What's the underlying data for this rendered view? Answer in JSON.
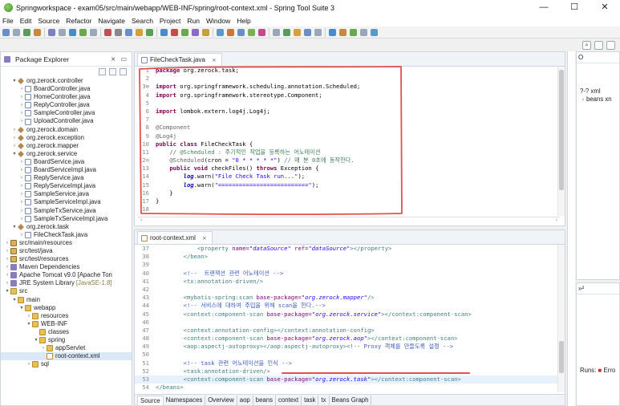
{
  "window": {
    "title": "Springworkspace - exam05/src/main/webapp/WEB-INF/spring/root-context.xml - Spring Tool Suite 3",
    "minimize": "—",
    "maximize": "☐",
    "close": "✕"
  },
  "menu": [
    "File",
    "Edit",
    "Source",
    "Refactor",
    "Navigate",
    "Search",
    "Project",
    "Run",
    "Window",
    "Help"
  ],
  "package_explorer": {
    "title": "Package Explorer",
    "tab_close": "⨯",
    "items": [
      {
        "depth": 1,
        "twisty": "v",
        "icon": "pkg",
        "label": "org.zerock.controller"
      },
      {
        "depth": 2,
        "twisty": ">",
        "icon": "java",
        "label": "BoardController.java"
      },
      {
        "depth": 2,
        "twisty": ">",
        "icon": "java",
        "label": "HomeController.java"
      },
      {
        "depth": 2,
        "twisty": ">",
        "icon": "java",
        "label": "ReplyController.java"
      },
      {
        "depth": 2,
        "twisty": ">",
        "icon": "java",
        "label": "SampleController.java"
      },
      {
        "depth": 2,
        "twisty": ">",
        "icon": "java",
        "label": "UploadController.java"
      },
      {
        "depth": 1,
        "twisty": ">",
        "icon": "pkg",
        "label": "org.zerock.domain"
      },
      {
        "depth": 1,
        "twisty": ">",
        "icon": "pkg",
        "label": "org.zerock.exception"
      },
      {
        "depth": 1,
        "twisty": ">",
        "icon": "pkg",
        "label": "org.zerock.mapper"
      },
      {
        "depth": 1,
        "twisty": "v",
        "icon": "pkg",
        "label": "org.zerock.service"
      },
      {
        "depth": 2,
        "twisty": ">",
        "icon": "java",
        "label": "BoardService.java"
      },
      {
        "depth": 2,
        "twisty": ">",
        "icon": "java",
        "label": "BoardServiceImpl.java"
      },
      {
        "depth": 2,
        "twisty": ">",
        "icon": "java",
        "label": "ReplyService.java"
      },
      {
        "depth": 2,
        "twisty": ">",
        "icon": "java",
        "label": "ReplyServiceImpl.java"
      },
      {
        "depth": 2,
        "twisty": ">",
        "icon": "java",
        "label": "SampleService.java"
      },
      {
        "depth": 2,
        "twisty": ">",
        "icon": "java",
        "label": "SampleServiceImpl.java"
      },
      {
        "depth": 2,
        "twisty": ">",
        "icon": "java",
        "label": "SampleTxService.java"
      },
      {
        "depth": 2,
        "twisty": ">",
        "icon": "java",
        "label": "SampleTxServiceImpl.java"
      },
      {
        "depth": 1,
        "twisty": "v",
        "icon": "pkg",
        "label": "org.zerock.task"
      },
      {
        "depth": 2,
        "twisty": ">",
        "icon": "java",
        "label": "FileCheckTask.java"
      },
      {
        "depth": 0,
        "twisty": ">",
        "icon": "src",
        "label": "src/main/resources"
      },
      {
        "depth": 0,
        "twisty": ">",
        "icon": "src",
        "label": "src/test/java"
      },
      {
        "depth": 0,
        "twisty": ">",
        "icon": "src",
        "label": "src/test/resources"
      },
      {
        "depth": 0,
        "twisty": ">",
        "icon": "lib",
        "label": "Maven Dependencies"
      },
      {
        "depth": 0,
        "twisty": ">",
        "icon": "lib",
        "label": "Apache Tomcat v9.0 [Apache Ton"
      },
      {
        "depth": 0,
        "twisty": ">",
        "icon": "lib",
        "label": "JRE System Library",
        "suffix": "[JavaSE-1.8]"
      },
      {
        "depth": 0,
        "twisty": "v",
        "icon": "folder",
        "label": "src"
      },
      {
        "depth": 1,
        "twisty": "v",
        "icon": "folder",
        "label": "main"
      },
      {
        "depth": 2,
        "twisty": "v",
        "icon": "folder",
        "label": "webapp"
      },
      {
        "depth": 3,
        "twisty": ">",
        "icon": "folder",
        "label": "resources"
      },
      {
        "depth": 3,
        "twisty": "v",
        "icon": "folder",
        "label": "WEB-INF"
      },
      {
        "depth": 4,
        "twisty": "",
        "icon": "folder",
        "label": "classes"
      },
      {
        "depth": 4,
        "twisty": "v",
        "icon": "folder",
        "label": "spring"
      },
      {
        "depth": 5,
        "twisty": ">",
        "icon": "folder",
        "label": "appServlet"
      },
      {
        "depth": 5,
        "twisty": "",
        "icon": "xml",
        "label": "root-context.xml",
        "selected": true
      },
      {
        "depth": 3,
        "twisty": ">",
        "icon": "folder",
        "label": "sql"
      }
    ]
  },
  "editor1": {
    "tab": "FileCheckTask.java",
    "lines": [
      {
        "n": "1",
        "segs": [
          [
            "kw",
            "package"
          ],
          [
            "t",
            " org.zerock.task;"
          ]
        ]
      },
      {
        "n": "2",
        "segs": []
      },
      {
        "n": "3⊕",
        "segs": [
          [
            "kw",
            "import"
          ],
          [
            "t",
            " org.springframework.scheduling.annotation.Scheduled;"
          ]
        ]
      },
      {
        "n": "4",
        "segs": [
          [
            "kw",
            "import"
          ],
          [
            "t",
            " org.springframework.stereotype.Component;"
          ]
        ]
      },
      {
        "n": "5",
        "segs": []
      },
      {
        "n": "6",
        "segs": [
          [
            "kw",
            "import"
          ],
          [
            "t",
            " lombok.extern.log4j.Log4j;"
          ]
        ]
      },
      {
        "n": "7",
        "segs": []
      },
      {
        "n": "8",
        "segs": [
          [
            "ann",
            "@Component"
          ]
        ]
      },
      {
        "n": "9",
        "segs": [
          [
            "ann",
            "@Log4j"
          ]
        ]
      },
      {
        "n": "10",
        "segs": [
          [
            "kw",
            "public class"
          ],
          [
            "t",
            " FileCheckTask {"
          ]
        ]
      },
      {
        "n": "11",
        "segs": [
          [
            "t",
            "    "
          ],
          [
            "cm",
            "// @Scheduled : 주기적인 작업을 등록하는 어노테이션"
          ]
        ]
      },
      {
        "n": "12⊖",
        "segs": [
          [
            "t",
            "    "
          ],
          [
            "ann",
            "@Scheduled"
          ],
          [
            "t",
            "(cron = "
          ],
          [
            "str",
            "\"0 * * * * *\""
          ],
          [
            "t",
            ") "
          ],
          [
            "cm",
            "// 매 분 0초에 동작한다."
          ]
        ]
      },
      {
        "n": "13",
        "segs": [
          [
            "t",
            "    "
          ],
          [
            "kw",
            "public void"
          ],
          [
            "t",
            " checkFiles() "
          ],
          [
            "kw",
            "throws"
          ],
          [
            "t",
            " Exception {"
          ]
        ]
      },
      {
        "n": "14",
        "segs": [
          [
            "t",
            "        "
          ],
          [
            "fld",
            "log"
          ],
          [
            "t",
            ".warn("
          ],
          [
            "str",
            "\"File Check Task run...\""
          ],
          [
            "t",
            ");"
          ]
        ]
      },
      {
        "n": "15",
        "segs": [
          [
            "t",
            "        "
          ],
          [
            "fld",
            "log"
          ],
          [
            "t",
            ".warn("
          ],
          [
            "str",
            "\"==========================\""
          ],
          [
            "t",
            ");"
          ]
        ]
      },
      {
        "n": "16",
        "segs": [
          [
            "t",
            "    }"
          ]
        ]
      },
      {
        "n": "17",
        "segs": [
          [
            "t",
            "}"
          ]
        ]
      },
      {
        "n": "18",
        "segs": []
      }
    ]
  },
  "editor2": {
    "tab": "root-context.xml",
    "lines": [
      {
        "n": "37",
        "segs": [
          [
            "t",
            "            "
          ],
          [
            "xtag",
            "<property "
          ],
          [
            "xattr",
            "name="
          ],
          [
            "xval",
            "\"dataSource\""
          ],
          [
            "xattr",
            " ref="
          ],
          [
            "xval",
            "\"dataSource\""
          ],
          [
            "xtag",
            "></property>"
          ]
        ]
      },
      {
        "n": "38",
        "segs": [
          [
            "t",
            "        "
          ],
          [
            "xtag",
            "</bean>"
          ]
        ]
      },
      {
        "n": "39",
        "segs": []
      },
      {
        "n": "40",
        "segs": [
          [
            "t",
            "        "
          ],
          [
            "xcm",
            "<!--  트랜잭션 관련 어노테이션 -->"
          ]
        ]
      },
      {
        "n": "41",
        "segs": [
          [
            "t",
            "        "
          ],
          [
            "xtag",
            "<tx:annotation-driven/>"
          ]
        ]
      },
      {
        "n": "42",
        "segs": []
      },
      {
        "n": "43",
        "segs": [
          [
            "t",
            "        "
          ],
          [
            "xtag",
            "<mybatis-spring:scan "
          ],
          [
            "xattr",
            "base-package="
          ],
          [
            "xval",
            "\"org.zerock.mapper\""
          ],
          [
            "xtag",
            "/>"
          ]
        ]
      },
      {
        "n": "44",
        "segs": [
          [
            "t",
            "        "
          ],
          [
            "xcm",
            "<!-- 서비스에 대하여 주입을 위해 scan을 한다.-->"
          ]
        ]
      },
      {
        "n": "45",
        "segs": [
          [
            "t",
            "        "
          ],
          [
            "xtag",
            "<context:component-scan "
          ],
          [
            "xattr",
            "base-package="
          ],
          [
            "xval",
            "\"org.zerock.service\""
          ],
          [
            "xtag",
            "></context:component-scan>"
          ]
        ]
      },
      {
        "n": "46",
        "segs": []
      },
      {
        "n": "47",
        "segs": [
          [
            "t",
            "        "
          ],
          [
            "xtag",
            "<context:annotation-config></context:annotation-config>"
          ]
        ]
      },
      {
        "n": "48",
        "segs": [
          [
            "t",
            "        "
          ],
          [
            "xtag",
            "<context:component-scan "
          ],
          [
            "xattr",
            "base-package="
          ],
          [
            "xval",
            "\"org.zerock.aop\""
          ],
          [
            "xtag",
            "></context:component-scan>"
          ]
        ]
      },
      {
        "n": "49",
        "segs": [
          [
            "t",
            "        "
          ],
          [
            "xtag",
            "<aop:aspectj-autoproxy></aop:aspectj-autoproxy>"
          ],
          [
            "xcm",
            "<!-- Proxy 객체를 만들도록 설정 -->"
          ]
        ]
      },
      {
        "n": "50",
        "segs": []
      },
      {
        "n": "51",
        "segs": [
          [
            "t",
            "        "
          ],
          [
            "xcm",
            "<!-- task 관련 어노테이션을 인식 -->"
          ]
        ]
      },
      {
        "n": "52",
        "segs": [
          [
            "t",
            "        "
          ],
          [
            "xtag",
            "<task:annotation-driven/>"
          ]
        ]
      },
      {
        "n": "53",
        "segs": [
          [
            "t",
            "        "
          ],
          [
            "xtag",
            "<context:component-scan "
          ],
          [
            "xattr",
            "base-package="
          ],
          [
            "xval",
            "\"org.zerock.task\""
          ],
          [
            "xtag",
            "></context:component-scan>"
          ]
        ]
      },
      {
        "n": "54",
        "segs": [
          [
            "xtag",
            "</beans>"
          ]
        ]
      }
    ],
    "bottom_tabs": [
      "Source",
      "Namespaces",
      "Overview",
      "aop",
      "beans",
      "context",
      "task",
      "tx",
      "Beans Graph"
    ]
  },
  "right_panel": {
    "outline_label": "O",
    "rows": [
      "?-? xml",
      "beans xn"
    ],
    "runs_label": "Runs:",
    "errors_label": "Erro"
  },
  "colors": {
    "annotation_red": "#e35050",
    "selection": "#dbe8f7"
  }
}
